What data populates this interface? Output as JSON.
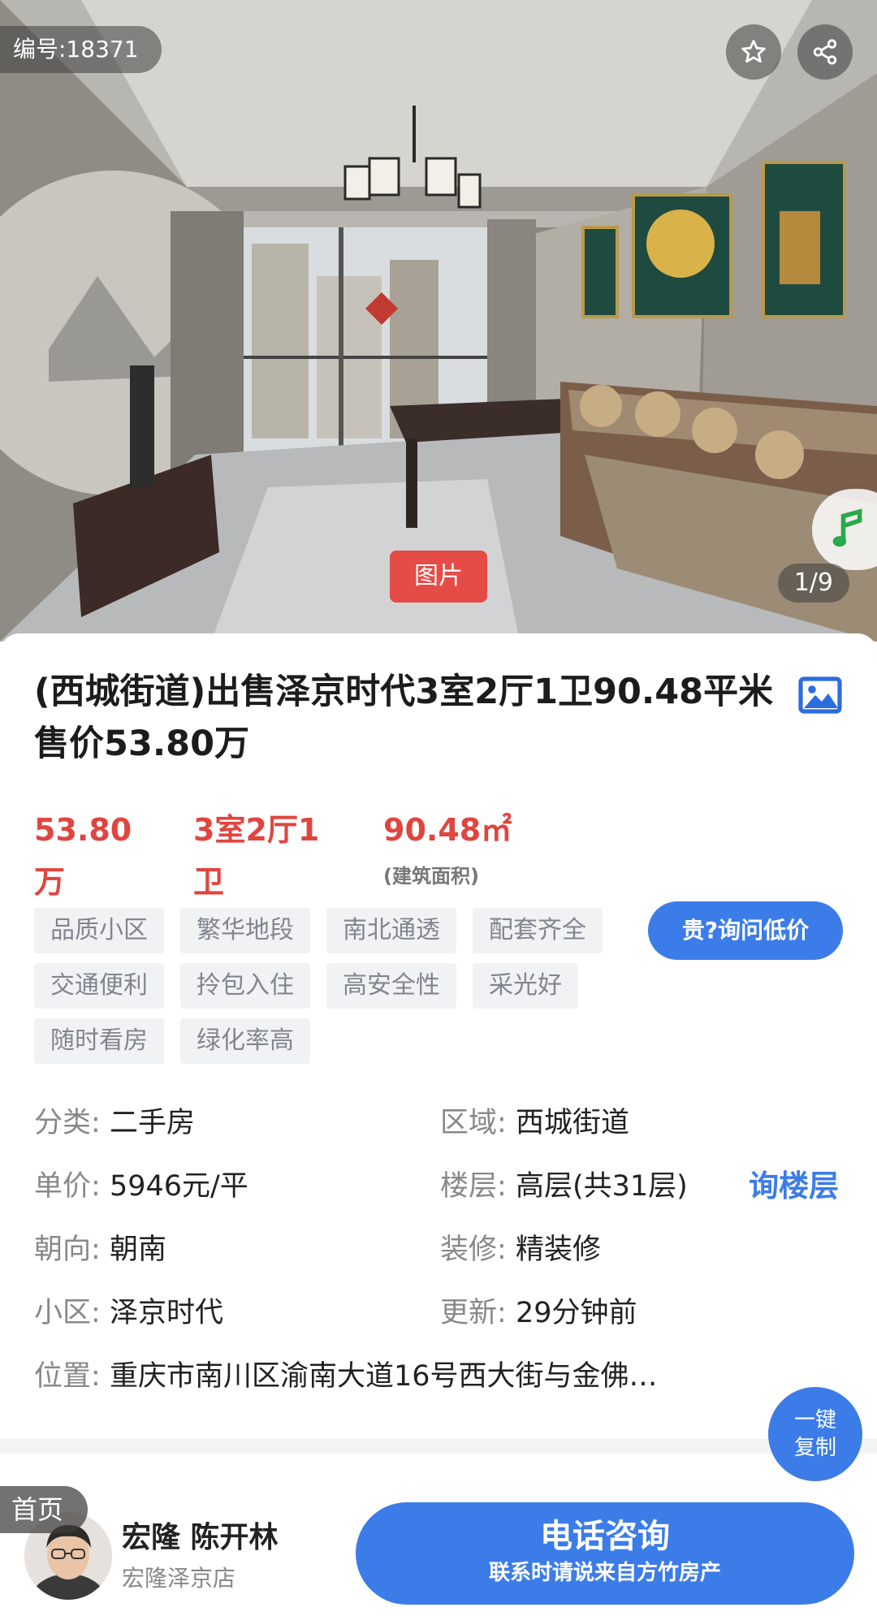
{
  "hero": {
    "listing_id": "编号:18371",
    "counter": "1/9",
    "photo_tag": "图片",
    "favorite_icon": "star-icon",
    "share_icon": "share-icon",
    "music_icon": "music-note-icon"
  },
  "listing": {
    "title": "(西城街道)出售泽京时代3室2厅1卫90.48平米 售价53.80万",
    "gallery_icon": "image-icon",
    "price": "53.80万",
    "layout": "3室2厅1卫",
    "area": "90.48㎡",
    "area_suffix": "(建筑面积)",
    "tags": [
      "品质小区",
      "繁华地段",
      "南北通透",
      "配套齐全",
      "交通便利",
      "拎包入住",
      "高安全性",
      "采光好",
      "随时看房",
      "绿化率高"
    ],
    "ask_price_button": "贵?询问低价"
  },
  "details": {
    "category_label": "分类:",
    "category_value": "二手房",
    "region_label": "区域:",
    "region_value": "西城街道",
    "unit_price_label": "单价:",
    "unit_price_value": "5946元/平",
    "floor_label": "楼层:",
    "floor_value": "高层(共31层)",
    "ask_floor_link": "询楼层",
    "orientation_label": "朝向:",
    "orientation_value": "朝南",
    "decoration_label": "装修:",
    "decoration_value": "精装修",
    "community_label": "小区:",
    "community_value": "泽京时代",
    "updated_label": "更新:",
    "updated_value": "29分钟前",
    "location_label": "位置:",
    "location_value": "重庆市南川区渝南大道16号西大街与金佛…",
    "copy_button_line1": "一键",
    "copy_button_line2": "复制"
  },
  "bottom_bar": {
    "home_label": "首页",
    "agent_name": "宏隆 陈开林",
    "agent_store": "宏隆泽京店",
    "call_main": "电话咨询",
    "call_sub": "联系时请说来自方竹房产"
  },
  "colors": {
    "accent_blue": "#3c7ce8",
    "price_red": "#e0453f",
    "tag_bg": "#f1f2f4"
  }
}
